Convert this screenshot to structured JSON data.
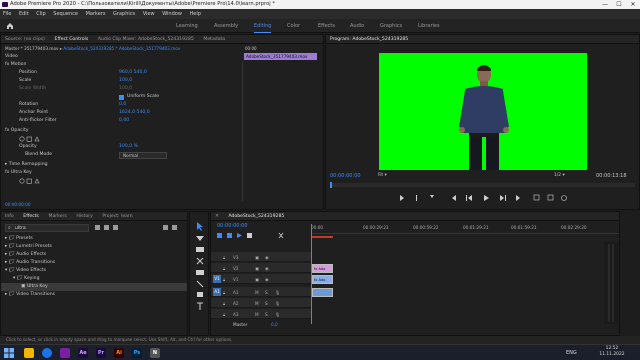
{
  "window": {
    "title": "Adobe Premiere Pro 2020 - C:\\Пользователи\\Kirill\\Документы\\Adobe\\Premiere Pro\\14.0\\learn.prproj *",
    "minimize": "—",
    "maximize": "☐",
    "close": "✕"
  },
  "menu": [
    "File",
    "Edit",
    "Clip",
    "Sequence",
    "Markers",
    "Graphics",
    "View",
    "Window",
    "Help"
  ],
  "workspaces": [
    "Learning",
    "Assembly",
    "Editing",
    "Color",
    "Effects",
    "Audio",
    "Graphics",
    "Libraries"
  ],
  "active_workspace": "Editing",
  "source_tabs": [
    "Source: (no clips)",
    "Effect Controls",
    "Audio Clip Mixer: AdobeStock_524319285",
    "Metadata"
  ],
  "effect_controls": {
    "breadcrumb_master": "Master * 351779403.mov",
    "breadcrumb_clip": "AdobeStock_524319285 * AdobeStock_351779403.mov",
    "timecode_start": "00:00",
    "clip_label": "AdobeStock_351779403.mov",
    "section_video": "Video",
    "motion": "Motion",
    "position_label": "Position",
    "position_values": "960,0    540,0",
    "scale_label": "Scale",
    "scale_value": "100,0",
    "scale_width_label": "Scale Width",
    "scale_width_value": "100,0",
    "uniform_scale": "Uniform Scale",
    "rotation_label": "Rotation",
    "rotation_value": "0,0",
    "anchor_label": "Anchor Point",
    "anchor_values": "1024,0    540,0",
    "antiflicker_label": "Anti-flicker Filter",
    "antiflicker_value": "0,00",
    "opacity": "Opacity",
    "opacity_label": "Opacity",
    "opacity_value": "100,0 %",
    "blend_label": "Blend Mode",
    "blend_value": "Normal",
    "time_remap": "Time Remapping",
    "ultra_key": "Ultra Key",
    "footer_timecode": "00:00:00:00"
  },
  "program": {
    "title": "Program: AdobeStock_524319285",
    "timecode": "00:00:00:00",
    "fit": "Fit",
    "quality": "1/2",
    "duration": "00:00:13:18",
    "bg_color": "#00ff00"
  },
  "project_tabs": [
    "Info",
    "Effects",
    "Markers",
    "History",
    "Project: learn"
  ],
  "search_value": "ultra",
  "effects_tree": [
    {
      "label": "Presets",
      "indent": 0
    },
    {
      "label": "Lumetri Presets",
      "indent": 0
    },
    {
      "label": "Audio Effects",
      "indent": 0
    },
    {
      "label": "Audio Transitions",
      "indent": 0
    },
    {
      "label": "Video Effects",
      "indent": 0
    },
    {
      "label": "Keying",
      "indent": 1
    },
    {
      "label": "Ultra Key",
      "indent": 2
    },
    {
      "label": "Video Transitions",
      "indent": 0
    }
  ],
  "timeline": {
    "tab": "AdobeStock_524319285",
    "timecode": "00:00:00:00",
    "ruler": [
      "00:00",
      "00:00:29:23",
      "00:00:59:22",
      "00:01:29:21",
      "00:01:59:21",
      "00:02:29:20"
    ],
    "video_tracks": [
      "V3",
      "V2",
      "V1"
    ],
    "audio_tracks": [
      "A1",
      "A2",
      "A3"
    ],
    "source_patch_v": "V1",
    "source_patch_a": "A1",
    "master_label": "Master",
    "master_value": "0,0",
    "clip_v2": "fx Ado",
    "clip_v1": "fx Ado"
  },
  "status_bar": "Click to select, or click in empty space and drag to marquee select. Use Shift, Alt, and Ctrl for other options.",
  "taskbar": {
    "lang": "ENG",
    "time": "12:52",
    "date": "11.11.2022",
    "apps": [
      "Ae",
      "Pr",
      "Ai",
      "Ps",
      "N"
    ]
  }
}
